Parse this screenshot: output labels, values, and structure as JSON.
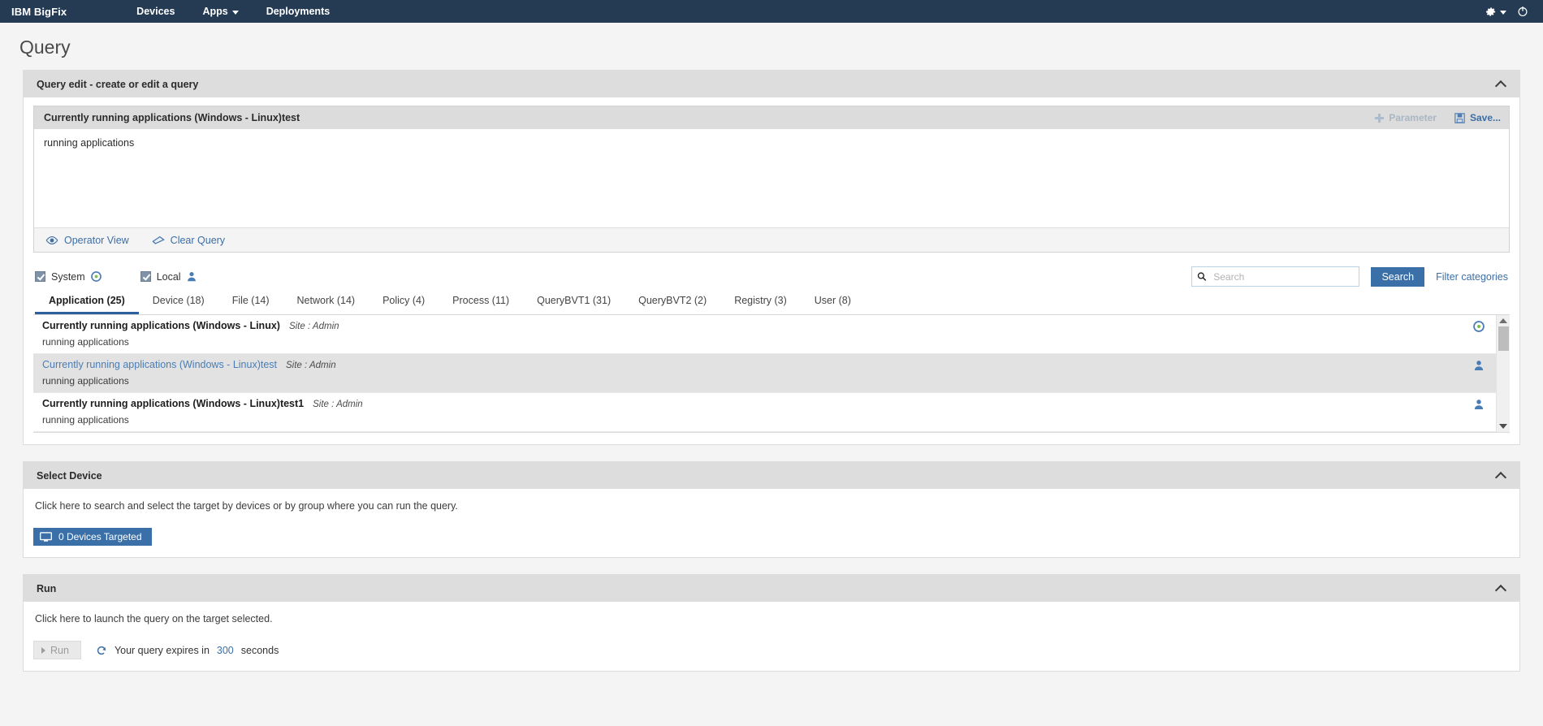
{
  "navbar": {
    "brand": "IBM BigFix",
    "links": [
      {
        "label": "Devices",
        "has_caret": false
      },
      {
        "label": "Apps",
        "has_caret": true
      },
      {
        "label": "Deployments",
        "has_caret": false
      }
    ],
    "gear_icon": "gear-icon",
    "power_icon": "power-icon",
    "bg_color": "#243b53"
  },
  "page": {
    "title": "Query"
  },
  "query_panel": {
    "header": "Query edit - create or edit a query",
    "collapse_icon": "chevron-up-icon",
    "query_name": "Currently running applications (Windows - Linux)test",
    "parameter_label": "Parameter",
    "parameter_enabled": false,
    "save_label": "Save...",
    "query_text": "running applications",
    "operator_view_label": "Operator View",
    "clear_query_label": "Clear Query"
  },
  "filters": {
    "system": {
      "label": "System",
      "checked": true,
      "icon": "system-clock-icon"
    },
    "local": {
      "label": "Local",
      "checked": true,
      "icon": "user-icon"
    },
    "search": {
      "placeholder": "Search",
      "value": "",
      "icon": "search-icon"
    },
    "search_button": "Search",
    "filter_categories": "Filter categories"
  },
  "tabs": [
    {
      "label": "Application (25)",
      "active": true
    },
    {
      "label": "Device (18)",
      "active": false
    },
    {
      "label": "File (14)",
      "active": false
    },
    {
      "label": "Network (14)",
      "active": false
    },
    {
      "label": "Policy (4)",
      "active": false
    },
    {
      "label": "Process (11)",
      "active": false
    },
    {
      "label": "QueryBVT1 (31)",
      "active": false
    },
    {
      "label": "QueryBVT2 (2)",
      "active": false
    },
    {
      "label": "Registry (3)",
      "active": false
    },
    {
      "label": "User (8)",
      "active": false
    }
  ],
  "results": [
    {
      "title": "Currently running applications (Windows - Linux)",
      "site": "Site : Admin",
      "description": "running applications",
      "icon": "system-clock-icon",
      "selected": false
    },
    {
      "title": "Currently running applications (Windows - Linux)test",
      "site": "Site : Admin",
      "description": "running applications",
      "icon": "user-icon",
      "selected": true
    },
    {
      "title": "Currently running applications (Windows - Linux)test1",
      "site": "Site : Admin",
      "description": "running applications",
      "icon": "user-icon",
      "selected": false
    }
  ],
  "select_device": {
    "header": "Select Device",
    "collapse_icon": "chevron-up-icon",
    "hint": "Click here to search and select the target by devices or by group where you can run the query.",
    "button_label": "0 Devices Targeted",
    "button_icon": "monitor-icon"
  },
  "run": {
    "header": "Run",
    "collapse_icon": "chevron-up-icon",
    "hint": "Click here to launch the query on the target selected.",
    "run_label": "Run",
    "run_enabled": false,
    "refresh_icon": "refresh-icon",
    "expire_prefix": "Your query expires in",
    "expire_seconds": "300",
    "expire_suffix": "seconds"
  },
  "colors": {
    "accent": "#3a6fa7",
    "navbar": "#243b53",
    "link": "#3c6ea5"
  }
}
